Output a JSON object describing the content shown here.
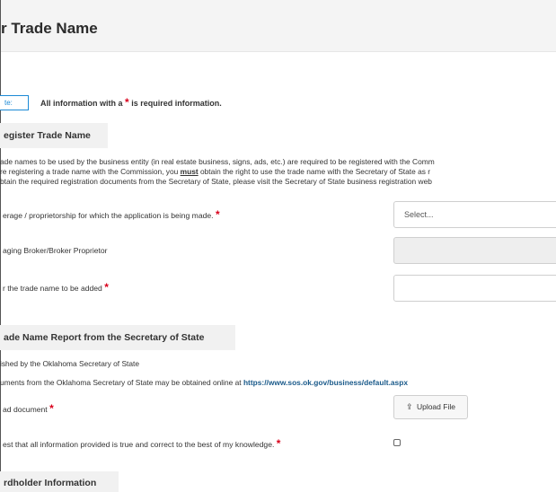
{
  "page": {
    "title": "r Trade Name"
  },
  "note": {
    "badge": "te:",
    "text_before": "All information with a",
    "asterisk": "*",
    "text_after": "is required information."
  },
  "register_section": {
    "heading": "egister Trade Name",
    "paragraph": [
      "ade names to be used by the business entity (in real estate business, signs, ads, etc.) are required to be registered with the Comm",
      "re registering a trade name with the Commission, you",
      "must",
      "obtain the right to use the trade name with the Secretary of State as r",
      "btain the required registration documents from the Secretary of State, please visit the Secretary of State business registration web"
    ],
    "fields": {
      "brokerage_label": "erage / proprietorship for which the application is being made.",
      "brokerage_placeholder": "Select...",
      "managing_broker_label": "aging Broker/Broker Proprietor",
      "trade_name_label": "r the trade name to be added"
    }
  },
  "report_section": {
    "heading": "ade Name Report from the Secretary of State",
    "line1": "ished by the Oklahoma Secretary of State",
    "line2_before": "uments from the Oklahoma Secretary of State may be obtained online at",
    "line2_link": "https://www.sos.ok.gov/business/default.aspx",
    "upload_label": "ad document",
    "upload_button": "Upload File",
    "attest_label": "est that all information provided is true and correct to the best of my knowledge."
  },
  "cardholder_section": {
    "heading": "rdholder Information"
  },
  "icons": {
    "upload": "upload-icon",
    "required": "asterisk"
  },
  "colors": {
    "required": "#d9001b",
    "note_border": "#1c8ad6",
    "link": "#1a5a8a"
  }
}
